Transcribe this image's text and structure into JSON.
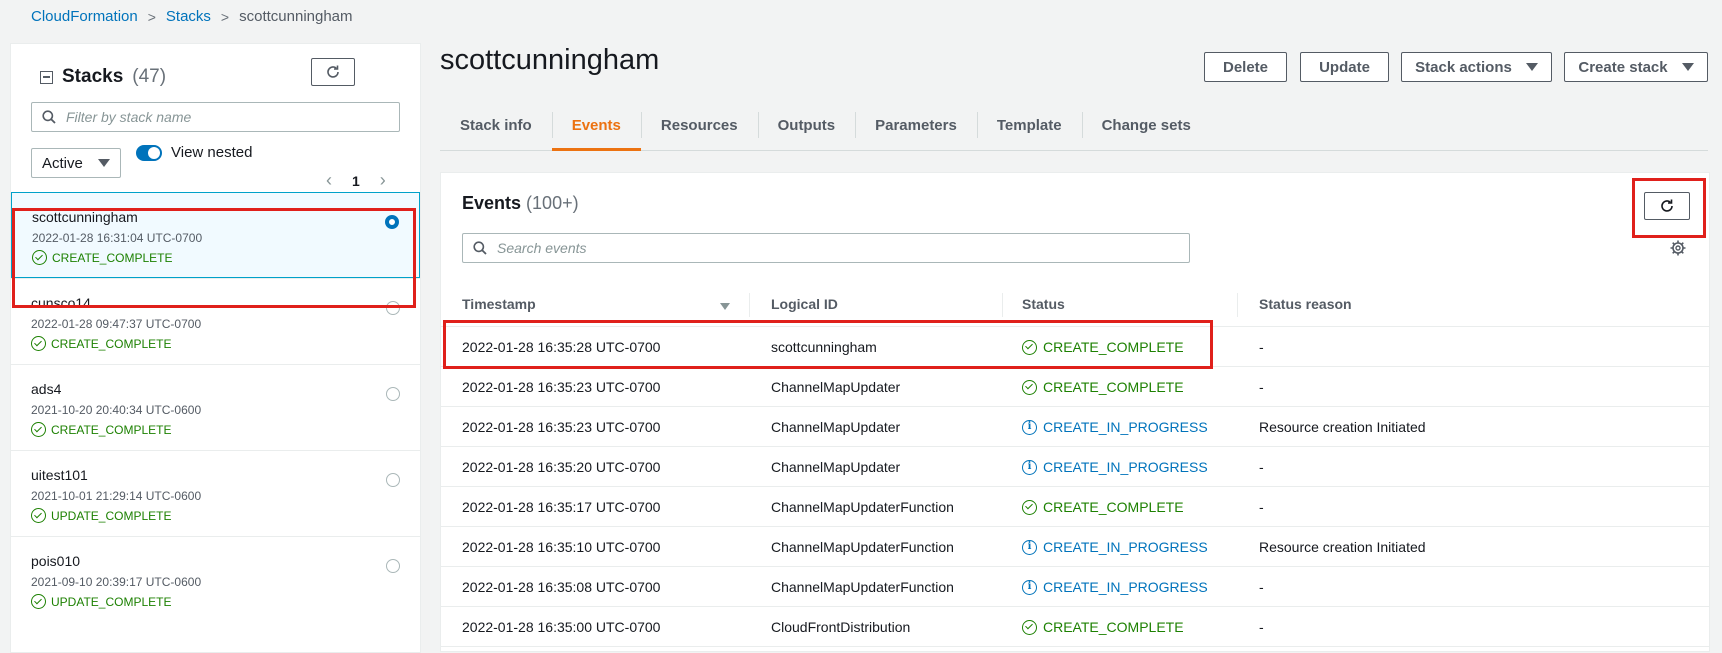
{
  "breadcrumb": {
    "root": "CloudFormation",
    "stacks": "Stacks",
    "current": "scottcunningham"
  },
  "stacks_panel": {
    "title": "Stacks",
    "count": "(47)",
    "filter_placeholder": "Filter by stack name",
    "status_filter": "Active",
    "view_nested_label": "View nested",
    "page": "1",
    "items": [
      {
        "name": "scottcunningham",
        "date": "2022-01-28 16:31:04 UTC-0700",
        "status": "CREATE_COMPLETE",
        "selected": true
      },
      {
        "name": "cunsco14",
        "date": "2022-01-28 09:47:37 UTC-0700",
        "status": "CREATE_COMPLETE",
        "selected": false
      },
      {
        "name": "ads4",
        "date": "2021-10-20 20:40:34 UTC-0600",
        "status": "CREATE_COMPLETE",
        "selected": false
      },
      {
        "name": "uitest101",
        "date": "2021-10-01 21:29:14 UTC-0600",
        "status": "UPDATE_COMPLETE",
        "selected": false
      },
      {
        "name": "pois010",
        "date": "2021-09-10 20:39:17 UTC-0600",
        "status": "UPDATE_COMPLETE",
        "selected": false
      }
    ]
  },
  "header": {
    "title": "scottcunningham",
    "delete_label": "Delete",
    "update_label": "Update",
    "stack_actions_label": "Stack actions",
    "create_stack_label": "Create stack"
  },
  "tabs": [
    {
      "label": "Stack info",
      "active": false
    },
    {
      "label": "Events",
      "active": true
    },
    {
      "label": "Resources",
      "active": false
    },
    {
      "label": "Outputs",
      "active": false
    },
    {
      "label": "Parameters",
      "active": false
    },
    {
      "label": "Template",
      "active": false
    },
    {
      "label": "Change sets",
      "active": false
    }
  ],
  "events": {
    "title": "Events",
    "count": "(100+)",
    "search_placeholder": "Search events",
    "columns": [
      "Timestamp",
      "Logical ID",
      "Status",
      "Status reason"
    ],
    "rows": [
      {
        "timestamp": "2022-01-28 16:35:28 UTC-0700",
        "logical_id": "scottcunningham",
        "status": "CREATE_COMPLETE",
        "reason": "-"
      },
      {
        "timestamp": "2022-01-28 16:35:23 UTC-0700",
        "logical_id": "ChannelMapUpdater",
        "status": "CREATE_COMPLETE",
        "reason": "-"
      },
      {
        "timestamp": "2022-01-28 16:35:23 UTC-0700",
        "logical_id": "ChannelMapUpdater",
        "status": "CREATE_IN_PROGRESS",
        "reason": "Resource creation Initiated"
      },
      {
        "timestamp": "2022-01-28 16:35:20 UTC-0700",
        "logical_id": "ChannelMapUpdater",
        "status": "CREATE_IN_PROGRESS",
        "reason": "-"
      },
      {
        "timestamp": "2022-01-28 16:35:17 UTC-0700",
        "logical_id": "ChannelMapUpdaterFunction",
        "status": "CREATE_COMPLETE",
        "reason": "-"
      },
      {
        "timestamp": "2022-01-28 16:35:10 UTC-0700",
        "logical_id": "ChannelMapUpdaterFunction",
        "status": "CREATE_IN_PROGRESS",
        "reason": "Resource creation Initiated"
      },
      {
        "timestamp": "2022-01-28 16:35:08 UTC-0700",
        "logical_id": "ChannelMapUpdaterFunction",
        "status": "CREATE_IN_PROGRESS",
        "reason": "-"
      },
      {
        "timestamp": "2022-01-28 16:35:00 UTC-0700",
        "logical_id": "CloudFrontDistribution",
        "status": "CREATE_COMPLETE",
        "reason": "-"
      }
    ]
  },
  "colors": {
    "accent": "#ec7211",
    "link": "#0073bb",
    "success": "#1d8102",
    "highlight": "#e0201b"
  }
}
